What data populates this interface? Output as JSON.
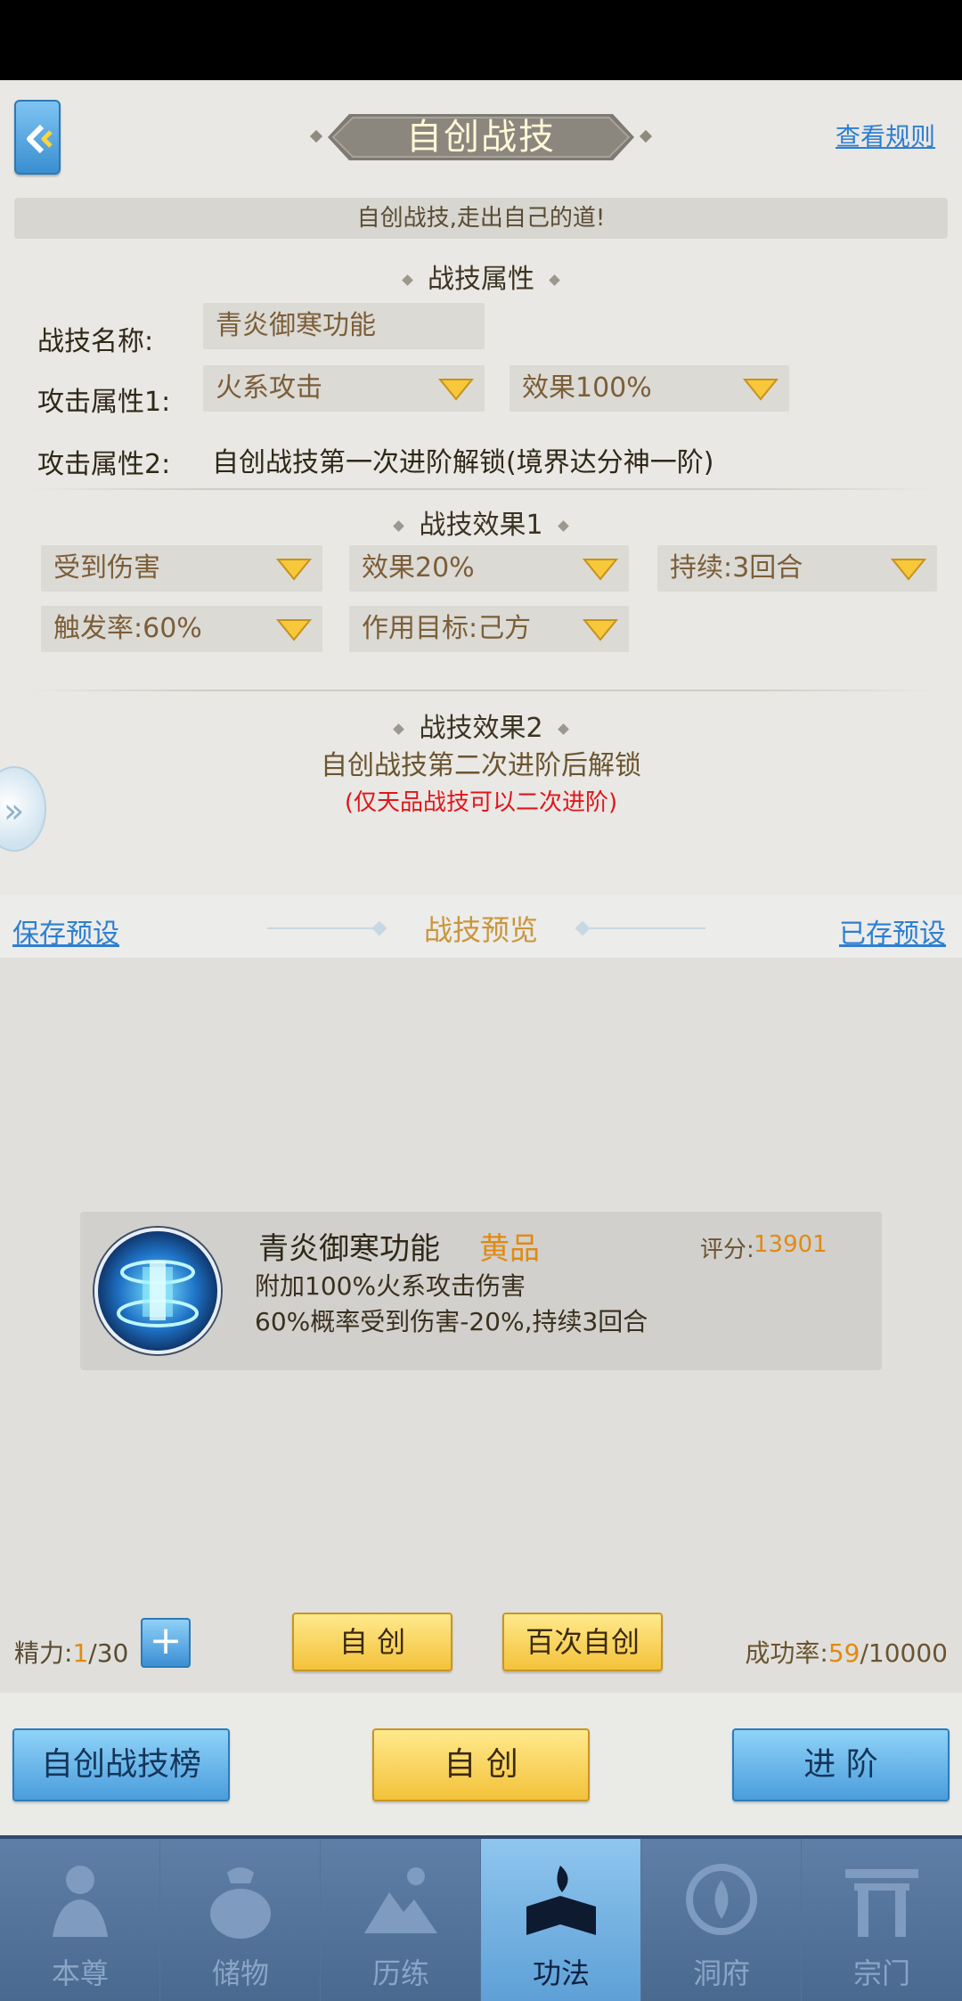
{
  "header": {
    "title": "自创战技",
    "rules_link": "查看规则"
  },
  "slogan": "自创战技,走出自己的道!",
  "attributes": {
    "section_title": "战技属性",
    "name_label": "战技名称:",
    "name_value": "青炎御寒功能",
    "attack1_label": "攻击属性1:",
    "attack1_type": "火系攻击",
    "attack1_effect": "效果100%",
    "attack2_label": "攻击属性2:",
    "attack2_text": "自创战技第一次进阶解锁(境界达分神一阶)"
  },
  "effect1": {
    "section_title": "战技效果1",
    "type": "受到伤害",
    "effect": "效果20%",
    "duration": "持续:3回合",
    "trigger": "触发率:60%",
    "target": "作用目标:己方"
  },
  "effect2": {
    "section_title": "战技效果2",
    "unlock_text": "自创战技第二次进阶后解锁",
    "note": "(仅天品战技可以二次进阶)"
  },
  "preview": {
    "save_preset": "保存预设",
    "title": "战技预览",
    "saved_presets": "已存预设"
  },
  "skill_card": {
    "name": "青炎御寒功能",
    "grade": "黄品",
    "score_label": "评分:",
    "score": "13901",
    "desc1": "附加100%火系攻击伤害",
    "desc2": "60%概率受到伤害-20%,持续3回合"
  },
  "controls": {
    "energy_label": "精力:",
    "energy_current": "1",
    "energy_max": "/30",
    "create_btn": "自 创",
    "hundred_btn": "百次自创",
    "success_label": "成功率:",
    "success_num": "59",
    "success_den": "/10000"
  },
  "actions": {
    "ranking": "自创战技榜",
    "create": "自 创",
    "advance": "进 阶"
  },
  "nav": {
    "items": [
      {
        "label": "本尊",
        "icon": "character-icon"
      },
      {
        "label": "储物",
        "icon": "bag-icon"
      },
      {
        "label": "历练",
        "icon": "mountain-icon"
      },
      {
        "label": "功法",
        "icon": "book-icon"
      },
      {
        "label": "洞府",
        "icon": "cave-icon"
      },
      {
        "label": "宗门",
        "icon": "sect-gate-icon"
      }
    ],
    "active": "功法"
  },
  "colors": {
    "accent_blue": "#2e7fd1",
    "gold": "#f3c23a",
    "orange": "#e08a14",
    "red_note": "#e0161c"
  }
}
